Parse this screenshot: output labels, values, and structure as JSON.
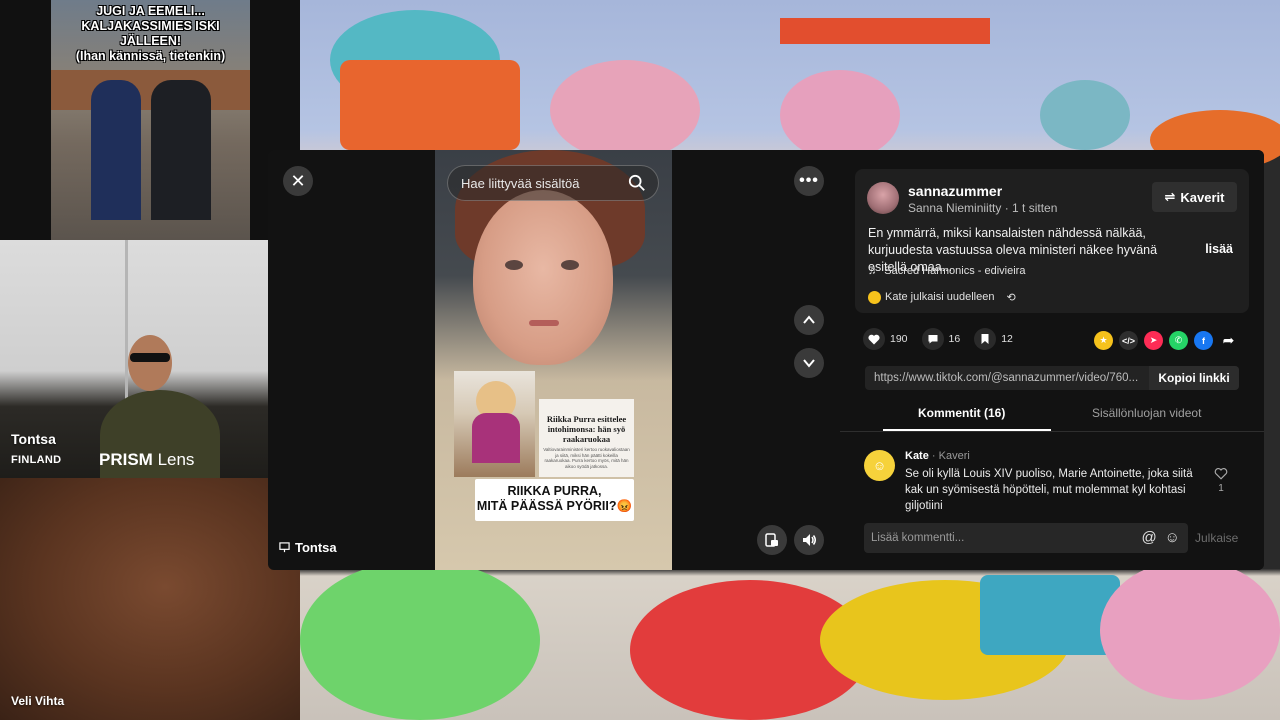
{
  "meme": {
    "caption": "JUGI JA EEMELI...\nKALJAKASSIMIES ISKI JÄLLEEN!\n(Ihan kännissä, tietenkin)"
  },
  "webcam": {
    "name": "Tontsa",
    "country": "FINLAND",
    "brand_bold": "PRISM",
    "brand_rest": " Lens"
  },
  "skin_tile": {
    "name": "Veli Vihta"
  },
  "video": {
    "search_placeholder": "Hae liittyvää sisältöä",
    "article_title": "Riikka Purra esittelee intohimonsa: hän syö raakaruokaa",
    "article_body": "Valtiovarainministeri kertoo ruokavaliostaan ja siitä, miksi hän päätti kokeilla raakaruokaa. Purra kertoo myös, mitä hän aikoo syödä jatkossa.",
    "banner": "RIIKKA PURRA,\nMITÄ PÄÄSSÄ PYÖRII?😡",
    "creator_label": "Tontsa"
  },
  "post": {
    "username": "sannazummer",
    "display_name": "Sanna Nieminiitty",
    "time": "1 t sitten",
    "friends_label": "Kaverit",
    "description": "En ymmärrä, miksi kansalaisten nähdessä nälkää, kurjuudesta vastuussa oleva ministeri näkee hyvänä esitellä omaa...",
    "more": "lisää",
    "music": "Sacred Harmonics - edivieira",
    "repost_text": "Kate julkaisi uudelleen"
  },
  "stats": {
    "likes": "190",
    "comments": "16",
    "saves": "12"
  },
  "link": {
    "url": "https://www.tiktok.com/@sannazummer/video/760...",
    "copy_label": "Kopioi linkki"
  },
  "tabs": [
    {
      "label": "Kommentit (16)"
    },
    {
      "label": "Sisällönluojan videot"
    }
  ],
  "comment": {
    "author": "Kate",
    "author_tag": " · Kaveri",
    "text": "Se oli kyllä Louis XIV puoliso, Marie Antoinette, joka siitä kak un syömisestä höpötteli, mut molemmat kyl kohtasi giljotiini",
    "likes": "1"
  },
  "composer": {
    "placeholder": "Lisää kommentti...",
    "publish": "Julkaise"
  },
  "colors": {
    "accent_pink": "#fe2c55",
    "whatsapp": "#25d366",
    "facebook": "#1877f2",
    "gold": "#f6c21c"
  }
}
